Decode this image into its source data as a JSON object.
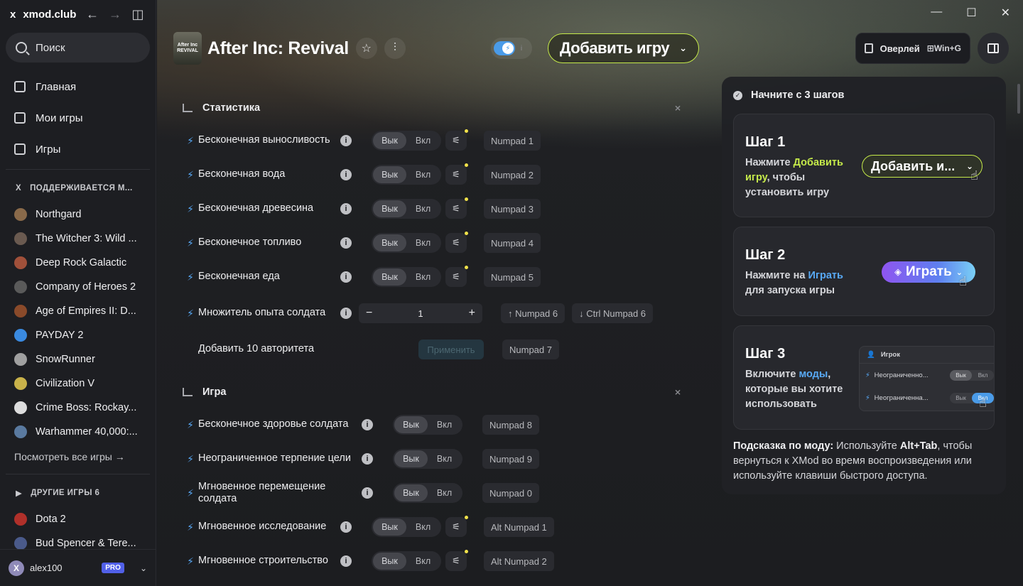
{
  "app": {
    "logo": "x",
    "site": "xmod.club",
    "back": "←",
    "forward": "→",
    "sidebar_toggle": "◫"
  },
  "window_controls": {
    "minimize": "—",
    "maximize": "☐",
    "close": "✕"
  },
  "search": {
    "placeholder": "Поиск"
  },
  "nav": [
    {
      "label": "Главная",
      "icon": "home-icon"
    },
    {
      "label": "Мои игры",
      "icon": "grid-icon"
    },
    {
      "label": "Игры",
      "icon": "games-icon"
    }
  ],
  "supported": {
    "header": "ПОДДЕРЖИВАЕТСЯ М...",
    "games": [
      {
        "name": "Northgard",
        "color": "#8a6a4a"
      },
      {
        "name": "The Witcher 3: Wild ...",
        "color": "#6a5a50"
      },
      {
        "name": "Deep Rock Galactic",
        "color": "#a0503a"
      },
      {
        "name": "Company of Heroes 2",
        "color": "#5a5a5a"
      },
      {
        "name": "Age of Empires II: D...",
        "color": "#8a4a2a"
      },
      {
        "name": "PAYDAY 2",
        "color": "#3a8ae0"
      },
      {
        "name": "SnowRunner",
        "color": "#a0a0a0"
      },
      {
        "name": "Civilization V",
        "color": "#c9b24a"
      },
      {
        "name": "Crime Boss: Rockay...",
        "color": "#dddddd"
      },
      {
        "name": "Warhammer 40,000:...",
        "color": "#5a7aa0"
      }
    ],
    "see_all": "Посмотреть все игры →"
  },
  "other": {
    "header": "ДРУГИЕ ИГРЫ 6",
    "games": [
      {
        "name": "Dota 2",
        "color": "#b0302a"
      },
      {
        "name": "Bud Spencer & Tere...",
        "color": "#4a5a8a"
      }
    ]
  },
  "user": {
    "name": "alex100",
    "initial": "X",
    "badge": "PRO"
  },
  "header": {
    "title": "After Inc: Revival",
    "icon_text": "After Inc REVIVAL",
    "add_game": "Добавить игру",
    "overlay": "Оверлей",
    "overlay_key": "⊞Win+G"
  },
  "toggle": {
    "info": "i"
  },
  "labels": {
    "off": "Вык",
    "on": "Вкл"
  },
  "categories": [
    {
      "title": "Статистика",
      "rows": [
        {
          "name": "Бесконечная выносливость",
          "type": "toggle",
          "key": "Numpad 1"
        },
        {
          "name": "Бесконечная вода",
          "type": "toggle",
          "key": "Numpad 2"
        },
        {
          "name": "Бесконечная древесина",
          "type": "toggle",
          "key": "Numpad 3"
        },
        {
          "name": "Бесконечное топливо",
          "type": "toggle",
          "key": "Numpad 4"
        },
        {
          "name": "Бесконечная еда",
          "type": "toggle",
          "key": "Numpad 5"
        },
        {
          "name": "Множитель опыта солдата",
          "type": "stepper",
          "value": "1",
          "key_up": "↑ Numpad 6",
          "key_down": "↓ Ctrl Numpad 6"
        },
        {
          "name": "Добавить 10 авторитета",
          "type": "apply",
          "apply_label": "Применить",
          "key": "Numpad 7"
        }
      ]
    },
    {
      "title": "Игра",
      "rows": [
        {
          "name": "Бесконечное здоровье солдата",
          "type": "toggle",
          "key": "Numpad 8"
        },
        {
          "name": "Неограниченное терпение цели",
          "type": "toggle",
          "key": "Numpad 9"
        },
        {
          "name": "Мгновенное перемещение солдата",
          "type": "toggle",
          "key": "Numpad 0"
        },
        {
          "name": "Мгновенное исследование",
          "type": "toggle",
          "key": "Alt Numpad 1"
        },
        {
          "name": "Мгновенное строительство",
          "type": "toggle",
          "key": "Alt Numpad 2"
        }
      ]
    }
  ],
  "right_panel": {
    "title": "Начните с 3 шагов",
    "step1": {
      "title": "Шаг 1",
      "pre": "Нажмите ",
      "link": "Добавить игру",
      "post": ", чтобы установить игру",
      "button": "Добавить и..."
    },
    "step2": {
      "title": "Шаг 2",
      "pre": "Нажмите на ",
      "link": "Играть",
      "post": " для запуска игры",
      "button": "Играть"
    },
    "step3": {
      "title": "Шаг 3",
      "pre": "Включите ",
      "link": "моды",
      "post": ", которые вы хотите использовать",
      "mini_header": "Игрок",
      "mini_row1": "Неограниченно...",
      "mini_row2": "Неограниченна...",
      "mini_off": "Вык",
      "mini_on": "Вкл"
    },
    "tip_label": "Подсказка по моду:",
    "tip_pre": " Используйте ",
    "tip_key": "Alt+Tab",
    "tip_post": ", чтобы вернуться к XMod во время воспроизведения или используйте клавиши быстрого доступа."
  },
  "colors": {
    "accent_green": "#c5ea4a",
    "accent_blue": "#58a9f5",
    "pro_badge": "#5160e8"
  }
}
